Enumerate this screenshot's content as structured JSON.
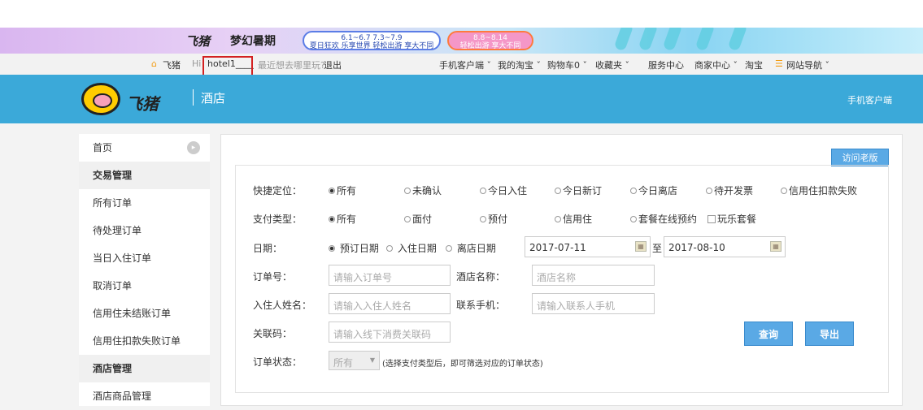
{
  "promo": {
    "logo": "飞猪",
    "campaign": "梦幻暑期",
    "pill1_line1": "6.1~6.7         7.3~7.9",
    "pill1_line2": "夏日狂欢 乐享世界   轻松出游 享大不同",
    "pill2_line1": "8.8~8.14",
    "pill2_line2": "轻松出游 享大不同"
  },
  "topnav": {
    "home": "飞猪",
    "hi": "Hi",
    "username": "hotel1____",
    "prompt": "最近想去哪里玩?",
    "logout": "退出",
    "links": [
      "手机客户端 ˇ",
      "我的淘宝 ˇ",
      "购物车0 ˇ",
      "收藏夹 ˇ",
      "服务中心",
      "商家中心 ˇ",
      "淘宝",
      "网站导航 ˇ"
    ]
  },
  "header": {
    "brand": "飞猪",
    "section": "酒店",
    "mobile": "手机客户端"
  },
  "sidebar": {
    "items": [
      {
        "label": "首页"
      },
      {
        "label": "交易管理"
      },
      {
        "label": "所有订单"
      },
      {
        "label": "待处理订单"
      },
      {
        "label": "当日入住订单"
      },
      {
        "label": "取消订单"
      },
      {
        "label": "信用住未结账订单"
      },
      {
        "label": "信用住扣款失败订单"
      },
      {
        "label": "酒店管理"
      },
      {
        "label": "酒店商品管理"
      }
    ]
  },
  "main": {
    "old_version": "访问老版",
    "quick_label": "快捷定位：",
    "quick_opts": [
      "所有",
      "未确认",
      "今日入住",
      "今日新订",
      "今日离店",
      "待开发票",
      "信用住扣款失败"
    ],
    "pay_label": "支付类型：",
    "pay_opts": [
      "所有",
      "面付",
      "预付",
      "信用住",
      "套餐在线预约"
    ],
    "pay_check": "玩乐套餐",
    "date_label": "日期：",
    "date_opts": [
      "预订日期",
      "入住日期",
      "离店日期"
    ],
    "date_from": "2017-07-11",
    "date_to_label": "至",
    "date_to": "2017-08-10",
    "order_no_label": "订单号：",
    "order_no_ph": "请输入订单号",
    "hotel_name_label": "酒店名称：",
    "hotel_name_ph": "酒店名称",
    "guest_label": "入住人姓名：",
    "guest_ph": "请输入入住人姓名",
    "phone_label": "联系手机：",
    "phone_ph": "请输入联系人手机",
    "code_label": "关联码：",
    "code_ph": "请输入线下消费关联码",
    "status_label": "订单状态：",
    "status_value": "所有",
    "status_hint": "(选择支付类型后，即可筛选对应的订单状态)",
    "query": "查询",
    "export": "导出"
  }
}
